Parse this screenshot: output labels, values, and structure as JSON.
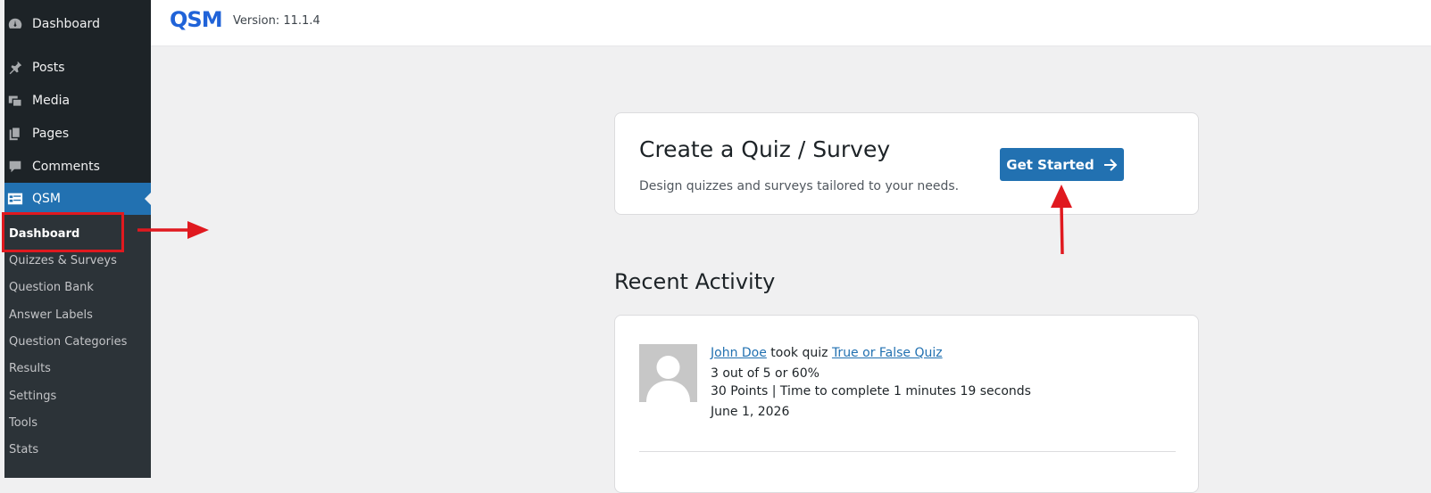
{
  "sidebar": {
    "items": [
      {
        "label": "Dashboard",
        "icon": "dashboard-icon"
      },
      {
        "label": "Posts",
        "icon": "pin-icon"
      },
      {
        "label": "Media",
        "icon": "media-icon"
      },
      {
        "label": "Pages",
        "icon": "pages-icon"
      },
      {
        "label": "Comments",
        "icon": "comment-icon"
      },
      {
        "label": "QSM",
        "icon": "qsm-icon"
      }
    ],
    "submenu": [
      "Dashboard",
      "Quizzes & Surveys",
      "Question Bank",
      "Answer Labels",
      "Question Categories",
      "Results",
      "Settings",
      "Tools",
      "Stats"
    ],
    "current_submenu": "Dashboard"
  },
  "header": {
    "logo": "QSM",
    "version": "Version: 11.1.4"
  },
  "create_card": {
    "title": "Create a Quiz / Survey",
    "description": "Design quizzes and surveys tailored to your needs.",
    "button_label": "Get Started"
  },
  "recent_activity": {
    "title": "Recent Activity",
    "entries": [
      {
        "user": "John Doe",
        "action": " took quiz ",
        "quiz": "True or False Quiz",
        "score": "3 out of 5 or 60%",
        "details": "30 Points | Time to complete 1 minutes 19 seconds",
        "date": "June 1, 2026"
      }
    ]
  },
  "colors": {
    "sidebar_bg": "#1d2327",
    "submenu_bg": "#2c3338",
    "accent": "#2271b1",
    "annotation": "#e0191f",
    "logo": "#2063d8"
  }
}
